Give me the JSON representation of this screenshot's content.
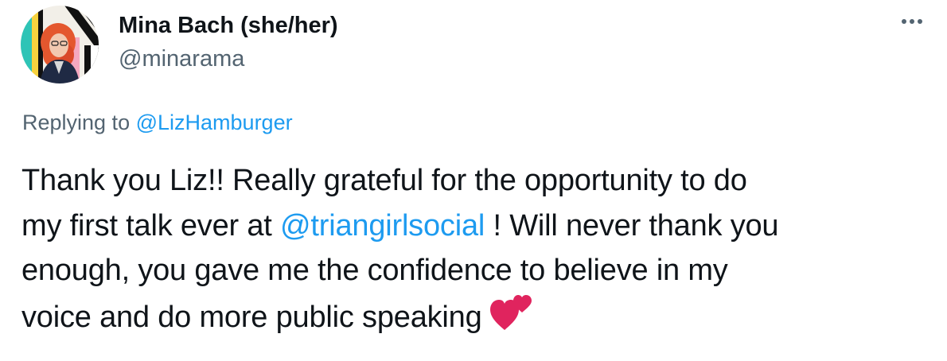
{
  "author": {
    "display_name": "Mina Bach (she/her)",
    "handle": "@minarama"
  },
  "reply_context": {
    "prefix": "Replying to",
    "target": "@LizHamburger"
  },
  "tweet": {
    "line1": "Thank you Liz!! Really grateful for the opportunity to do",
    "line2_before": "my first talk ever at",
    "line2_mention": "@triangirlsocial",
    "line2_after": "! Will never thank you",
    "line3": "enough, you gave me the confidence to believe in my",
    "line4": "voice and do more public speaking"
  },
  "icons": {
    "more": "more-horizontal-icon",
    "emoji": "two-hearts-emoji"
  },
  "colors": {
    "link": "#1d9bf0",
    "secondary_text": "#536471",
    "primary_text": "#0f1419",
    "heart": "#e0245e"
  }
}
